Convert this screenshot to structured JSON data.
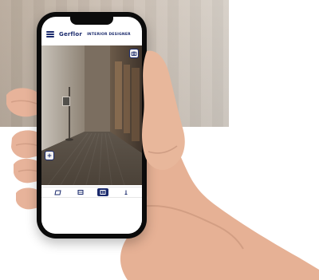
{
  "app": {
    "brand": "Gerflor",
    "title": "INTERIOR DESIGNER"
  },
  "icons": {
    "menu": "hamburger-menu-icon",
    "camera": "camera-icon",
    "add": "plus-icon",
    "toolbar": [
      "floor-icon",
      "wall-icon",
      "room-icon",
      "measure-icon"
    ]
  },
  "colors": {
    "brand": "#1a2a6c",
    "phone": "#0b0b0b",
    "skin": "#e8b79b"
  },
  "toolbar": {
    "active_index": 2
  }
}
